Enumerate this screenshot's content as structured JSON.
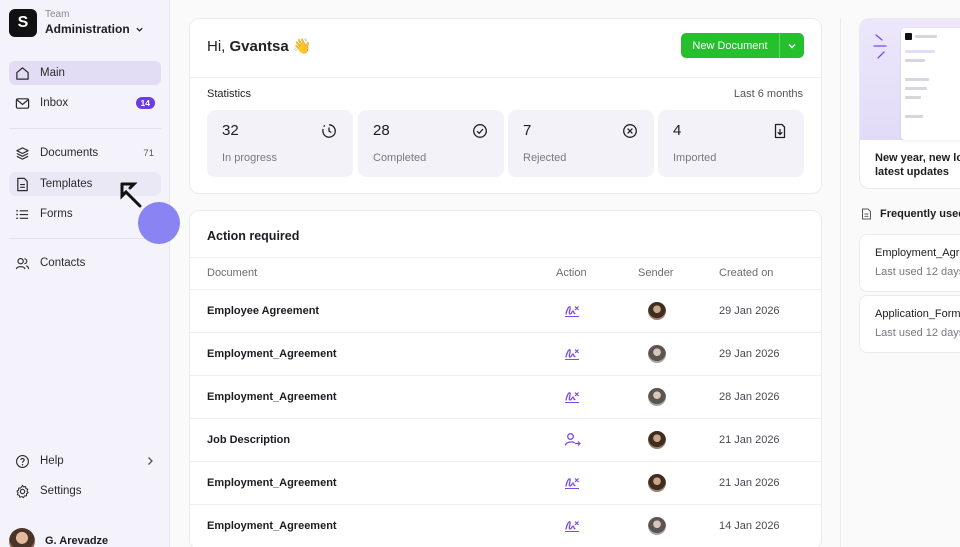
{
  "team": {
    "logo": "S",
    "label": "Team",
    "name": "Administration"
  },
  "nav": {
    "main": "Main",
    "inbox": "Inbox",
    "inbox_badge": "14",
    "documents": "Documents",
    "documents_count": "71",
    "templates": "Templates",
    "forms": "Forms",
    "contacts": "Contacts",
    "help": "Help",
    "settings": "Settings"
  },
  "user": {
    "name": "G. Arevadze"
  },
  "greeting": {
    "prefix": "Hi,",
    "name": "Gvantsa",
    "emoji": "👋"
  },
  "new_document": {
    "label": "New Document"
  },
  "statistics": {
    "title": "Statistics",
    "range": "Last 6 months",
    "items": [
      {
        "value": "32",
        "label": "In progress",
        "icon": "clock-icon"
      },
      {
        "value": "28",
        "label": "Completed",
        "icon": "check-circle-icon"
      },
      {
        "value": "7",
        "label": "Rejected",
        "icon": "x-circle-icon"
      },
      {
        "value": "4",
        "label": "Imported",
        "icon": "file-import-icon"
      }
    ]
  },
  "action_required": {
    "title": "Action required",
    "columns": [
      "Document",
      "Action",
      "Sender",
      "Created on"
    ],
    "rows": [
      {
        "document": "Employee Agreement",
        "action": "sign-icon",
        "date": "29 Jan 2026"
      },
      {
        "document": "Employment_Agreement",
        "action": "sign-icon",
        "date": "29 Jan 2026"
      },
      {
        "document": "Employment_Agreement",
        "action": "sign-icon",
        "date": "28 Jan 2026"
      },
      {
        "document": "Job Description",
        "action": "assign-user-icon",
        "date": "21 Jan 2026"
      },
      {
        "document": "Employment_Agreement",
        "action": "sign-icon",
        "date": "21 Jan 2026"
      },
      {
        "document": "Employment_Agreement",
        "action": "sign-icon",
        "date": "14 Jan 2026"
      }
    ]
  },
  "promo": {
    "line1": "New year, new lo",
    "line2": "latest updates"
  },
  "frequently_used": {
    "title": "Frequently used",
    "items": [
      {
        "name": "Employment_Agre",
        "used": "Last used 12 days"
      },
      {
        "name": "Application_Form",
        "used": "Last used 12 days"
      }
    ]
  },
  "colors": {
    "accent": "#6b3ce0",
    "primary_button": "#26c02f",
    "sidebar_bg": "#f4f2fa"
  }
}
